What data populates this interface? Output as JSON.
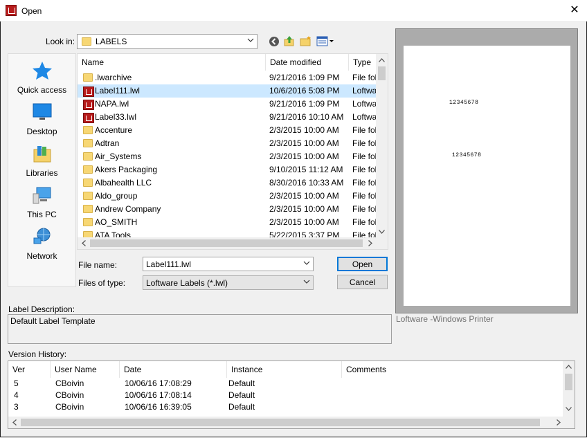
{
  "window": {
    "title": "Open"
  },
  "look_in": {
    "label": "Look in:",
    "value": "LABELS"
  },
  "places": [
    {
      "label": "Quick access",
      "icon": "star-icon"
    },
    {
      "label": "Desktop",
      "icon": "desktop-icon"
    },
    {
      "label": "Libraries",
      "icon": "libraries-icon"
    },
    {
      "label": "This PC",
      "icon": "computer-icon"
    },
    {
      "label": "Network",
      "icon": "network-icon"
    }
  ],
  "file_list": {
    "columns": [
      "Name",
      "Date modified",
      "Type"
    ],
    "rows": [
      {
        "icon": "folder",
        "name": ".lwarchive",
        "date": "9/21/2016 1:09 PM",
        "type": "File fol"
      },
      {
        "icon": "lwl",
        "name": "Label111.lwl",
        "date": "10/6/2016 5:08 PM",
        "type": "Loftwa",
        "selected": true
      },
      {
        "icon": "lwl",
        "name": "NAPA.lwl",
        "date": "9/21/2016 1:09 PM",
        "type": "Loftwa"
      },
      {
        "icon": "lwl",
        "name": "Label33.lwl",
        "date": "9/21/2016 10:10 AM",
        "type": "Loftwa"
      },
      {
        "icon": "folder",
        "name": "Accenture",
        "date": "2/3/2015 10:00 AM",
        "type": "File fol"
      },
      {
        "icon": "folder",
        "name": "Adtran",
        "date": "2/3/2015 10:00 AM",
        "type": "File fol"
      },
      {
        "icon": "folder",
        "name": "Air_Systems",
        "date": "2/3/2015 10:00 AM",
        "type": "File fol"
      },
      {
        "icon": "folder",
        "name": "Akers Packaging",
        "date": "9/10/2015 11:12 AM",
        "type": "File fol"
      },
      {
        "icon": "folder",
        "name": "Albahealth LLC",
        "date": "8/30/2016 10:33 AM",
        "type": "File fol"
      },
      {
        "icon": "folder",
        "name": "Aldo_group",
        "date": "2/3/2015 10:00 AM",
        "type": "File fol"
      },
      {
        "icon": "folder",
        "name": "Andrew Company",
        "date": "2/3/2015 10:00 AM",
        "type": "File fol"
      },
      {
        "icon": "folder",
        "name": "AO_SMITH",
        "date": "2/3/2015 10:00 AM",
        "type": "File fol"
      },
      {
        "icon": "folder",
        "name": "ATA Tools",
        "date": "5/22/2015 3:37 PM",
        "type": "File fol"
      }
    ]
  },
  "file_name": {
    "label": "File name:",
    "value": "Label111.lwl"
  },
  "file_type": {
    "label": "Files of type:",
    "value": "Loftware Labels (*.lwl)"
  },
  "buttons": {
    "open": "Open",
    "cancel": "Cancel"
  },
  "preview": {
    "text1": "12345678",
    "text2": "12345678",
    "printer": "Loftware -Windows Printer"
  },
  "label_description": {
    "label": "Label Description:",
    "value": "Default Label Template"
  },
  "version_history": {
    "label": "Version History:",
    "columns": [
      "Ver",
      "User Name",
      "Date",
      "Instance",
      "Comments"
    ],
    "rows": [
      {
        "ver": "5",
        "user": "CBoivin",
        "date": "10/06/16 17:08:29",
        "instance": "Default",
        "comments": ""
      },
      {
        "ver": "4",
        "user": "CBoivin",
        "date": "10/06/16 17:08:14",
        "instance": "Default",
        "comments": ""
      },
      {
        "ver": "3",
        "user": "CBoivin",
        "date": "10/06/16 16:39:05",
        "instance": "Default",
        "comments": ""
      }
    ]
  }
}
